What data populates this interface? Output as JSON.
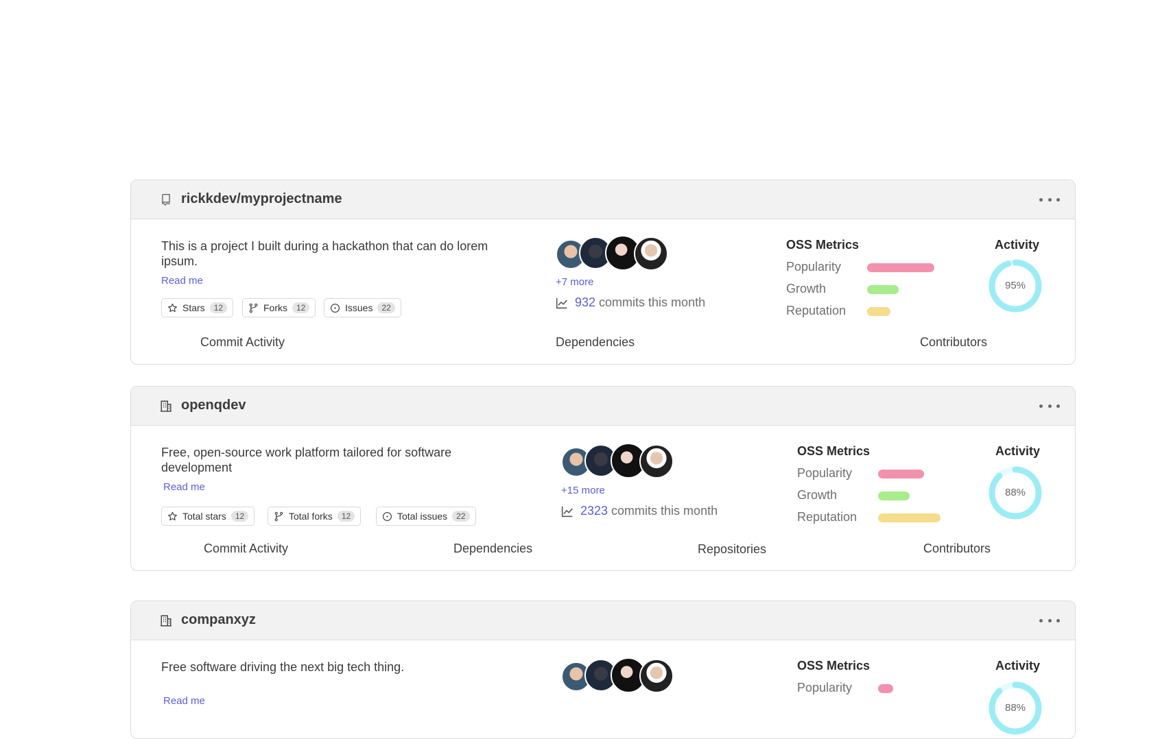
{
  "colors": {
    "accent": "#5a5fd6",
    "popularity": "#f391ad",
    "growth": "#a8ec8c",
    "reputation": "#f5dd8c",
    "activity_ring": "#9cecf5",
    "activity_track": "#e6fbfd"
  },
  "cards": [
    {
      "icon": "repo-icon",
      "title": "rickkdev/myprojectname",
      "description": "This is a project I built during a hackathon that can do lorem ipsum.",
      "readme": "Read me",
      "pills": [
        {
          "icon": "star-icon",
          "label": "Stars",
          "count": "12"
        },
        {
          "icon": "fork-icon",
          "label": "Forks",
          "count": "12"
        },
        {
          "icon": "issue-icon",
          "label": "Issues",
          "count": "22"
        }
      ],
      "more_contributors": "+7 more",
      "commits": {
        "count": "932",
        "text": "commits this month"
      },
      "metrics": {
        "title": "OSS Metrics",
        "items": [
          {
            "label": "Popularity",
            "level": 0.7
          },
          {
            "label": "Growth",
            "level": 0.33
          },
          {
            "label": "Reputation",
            "level": 0.24
          }
        ]
      },
      "activity": {
        "title": "Activity",
        "percent": 95,
        "label": "95%"
      },
      "links": [
        "Commit Activity",
        "Dependencies",
        "Contributors"
      ]
    },
    {
      "icon": "organization-icon",
      "title": "openqdev",
      "description": "Free, open-source work platform tailored for software development",
      "readme": "Read me",
      "pills": [
        {
          "icon": "star-icon",
          "label": "Total stars",
          "count": "12"
        },
        {
          "icon": "fork-icon",
          "label": "Total forks",
          "count": "12"
        },
        {
          "icon": "issue-icon",
          "label": "Total issues",
          "count": "22"
        }
      ],
      "more_contributors": "+15 more",
      "commits": {
        "count": "2323",
        "text": "commits this month"
      },
      "metrics": {
        "title": "OSS Metrics",
        "items": [
          {
            "label": "Popularity",
            "level": 0.48
          },
          {
            "label": "Growth",
            "level": 0.33
          },
          {
            "label": "Reputation",
            "level": 0.65
          }
        ]
      },
      "activity": {
        "title": "Activity",
        "percent": 88,
        "label": "88%"
      },
      "links": [
        "Commit Activity",
        "Dependencies",
        "Repositories",
        "Contributors"
      ]
    },
    {
      "icon": "organization-icon",
      "title": "companxyz",
      "description": "Free software driving the next big tech thing.",
      "readme": "Read me",
      "metrics": {
        "title": "OSS Metrics",
        "items": [
          {
            "label": "Popularity",
            "level": 0.16
          }
        ]
      },
      "activity": {
        "title": "Activity",
        "percent": 88,
        "label": "88%"
      }
    }
  ]
}
